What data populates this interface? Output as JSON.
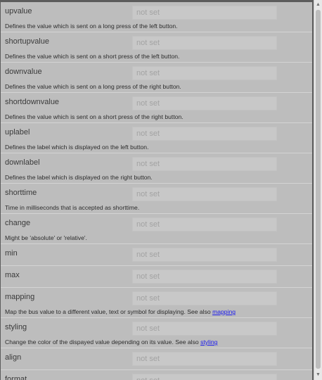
{
  "placeholder": "not set",
  "properties": [
    {
      "name": "upvalue",
      "desc": "Defines the value which is sent on a long press of the left button."
    },
    {
      "name": "shortupvalue",
      "desc": "Defines the value which is sent on a short press of the left button."
    },
    {
      "name": "downvalue",
      "desc": "Defines the value which is sent on a long press of the right button."
    },
    {
      "name": "shortdownvalue",
      "desc": "Defines the value which is sent on a short press of the right button."
    },
    {
      "name": "uplabel",
      "desc": "Defines the label which is displayed on the left button."
    },
    {
      "name": "downlabel",
      "desc": "Defines the label which is displayed on the right button."
    },
    {
      "name": "shorttime",
      "desc": "Time in milliseconds that is accepted as shorttime."
    },
    {
      "name": "change",
      "desc": "Might be 'absolute' or 'relative'."
    },
    {
      "name": "min"
    },
    {
      "name": "max"
    },
    {
      "name": "mapping",
      "desc": "Map the bus value to a different value, text or symbol for displaying. See also ",
      "link": "mapping"
    },
    {
      "name": "styling",
      "desc": "Change the color of the dispayed value depending on its value. See also ",
      "link": "styling"
    },
    {
      "name": "align"
    },
    {
      "name": "format"
    }
  ],
  "icons": {
    "scroll_up": "arrow-up-icon",
    "scroll_down": "arrow-down-icon"
  }
}
